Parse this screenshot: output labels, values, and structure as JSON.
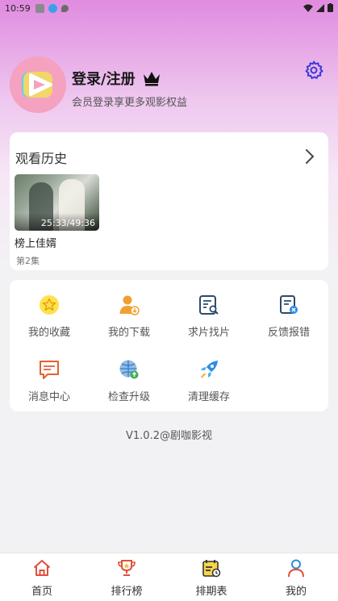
{
  "status_bar": {
    "time": "10:59"
  },
  "profile": {
    "login_label": "登录/注册",
    "subtitle": "会员登录享更多观影权益"
  },
  "history": {
    "title": "观看历史",
    "items": [
      {
        "title": "榜上佳婿",
        "episode": "第2集",
        "progress": "25:33/49:36"
      }
    ]
  },
  "menu": {
    "items": [
      {
        "label": "我的收藏",
        "icon": "star-icon"
      },
      {
        "label": "我的下载",
        "icon": "download-user-icon"
      },
      {
        "label": "求片找片",
        "icon": "search-document-icon"
      },
      {
        "label": "反馈报错",
        "icon": "feedback-error-icon"
      },
      {
        "label": "消息中心",
        "icon": "message-icon"
      },
      {
        "label": "检查升级",
        "icon": "globe-upgrade-icon"
      },
      {
        "label": "清理缓存",
        "icon": "rocket-icon"
      }
    ]
  },
  "version": "V1.0.2@剧咖影视",
  "tabbar": {
    "tabs": [
      {
        "label": "首页",
        "icon": "home-icon"
      },
      {
        "label": "排行榜",
        "icon": "trophy-icon"
      },
      {
        "label": "排期表",
        "icon": "schedule-icon"
      },
      {
        "label": "我的",
        "icon": "person-icon"
      }
    ]
  },
  "colors": {
    "accent": "#e0503a",
    "settings": "#3a3adb",
    "header_gradient_top": "#e08be0"
  }
}
